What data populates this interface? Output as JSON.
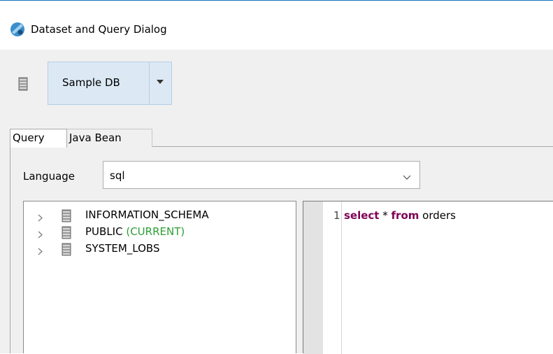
{
  "window": {
    "title": "Dataset and Query Dialog",
    "icon": "dataset-wizard-icon",
    "accent": "#1a73b8"
  },
  "toolbar": {
    "datasource_icon": "database-icon",
    "datasource_value": "Sample DB",
    "dropdown_icon": "dropdown-arrow-icon"
  },
  "tabs": [
    {
      "label": "Query",
      "selected": true
    },
    {
      "label": "Java Bean",
      "selected": false
    }
  ],
  "language": {
    "label": "Language",
    "value": "sql",
    "chevron_icon": "chevron-down-icon"
  },
  "schema_tree": {
    "items": [
      {
        "name": "INFORMATION_SCHEMA",
        "suffix": ""
      },
      {
        "name": "PUBLIC",
        "suffix": "(CURRENT)",
        "suffix_color": "#2e9e36"
      },
      {
        "name": "SYSTEM_LOBS",
        "suffix": ""
      }
    ],
    "item_icon": "database-icon",
    "expand_icon": "chevron-right-icon"
  },
  "editor": {
    "line_number": "1",
    "code": {
      "kw1": "select",
      "t1": " * ",
      "kw2": "from",
      "t2": " orders"
    },
    "keyword_color": "#7f0055"
  }
}
